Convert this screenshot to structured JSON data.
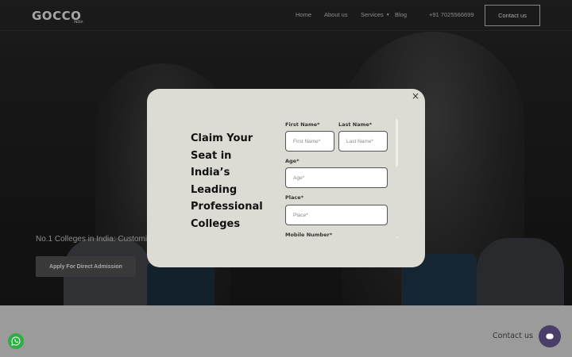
{
  "header": {
    "logo": "GOCCO",
    "logo_tag": "INDIA",
    "nav": {
      "home": "Home",
      "about": "About us",
      "services": "Services",
      "blog": "Blog",
      "phone": "+91 7025566699"
    },
    "contact_button": "Contact us"
  },
  "hero": {
    "subtitle": "No.1 Colleges in India: Customi",
    "apply_button": "Apply For Direct Admission"
  },
  "modal": {
    "close": "×",
    "heading": "Claim Your Seat in India’s Leading Professional Colleges",
    "form": {
      "first_name_label": "First Name*",
      "first_name_placeholder": "First Name*",
      "last_name_label": "Last Name*",
      "last_name_placeholder": "Last Name*",
      "age_label": "Age*",
      "age_placeholder": "Age*",
      "place_label": "Place*",
      "place_placeholder": "Place*",
      "mobile_label": "Mobile Number*"
    }
  },
  "widgets": {
    "chat_label": "Contact us",
    "whatsapp_icon": "whatsapp-icon",
    "chat_icon": "chat-icon",
    "whatsapp_color": "#2fae48",
    "chat_color": "#4a3d6a"
  }
}
